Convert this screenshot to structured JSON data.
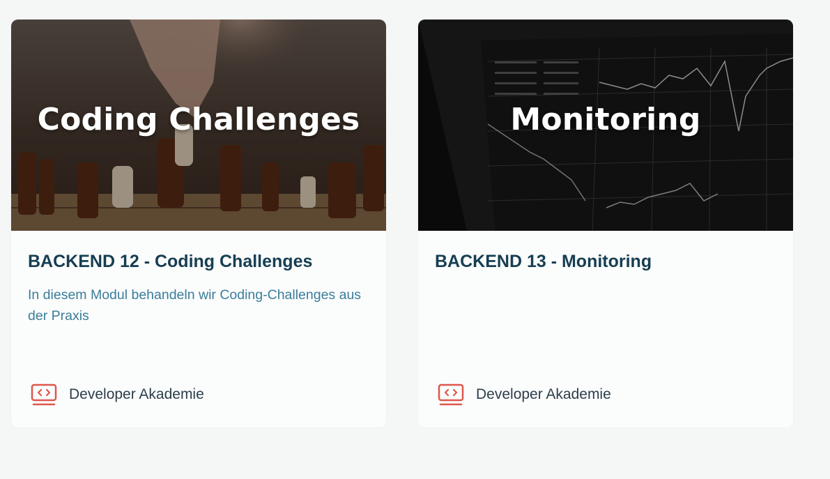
{
  "courses": [
    {
      "image_title": "Coding Challenges",
      "title": "BACKEND 12 - Coding Challenges",
      "description": "In diesem Modul behandeln wir Coding-Challenges aus der Praxis",
      "provider": "Developer Akademie",
      "image_subject": "chess-pieces-photo",
      "provider_icon": "code-monitor-icon"
    },
    {
      "image_title": "Monitoring",
      "title": "BACKEND 13 - Monitoring",
      "description": "",
      "provider": "Developer Akademie",
      "image_subject": "stock-charts-monitor-photo",
      "provider_icon": "code-monitor-icon"
    }
  ],
  "colors": {
    "page_bg": "#f5f6f6",
    "card_bg": "#fbfcfc",
    "title": "#163e52",
    "description": "#3a7d9b",
    "provider_icon": "#e0564c",
    "provider_text": "#2c3e4a"
  }
}
